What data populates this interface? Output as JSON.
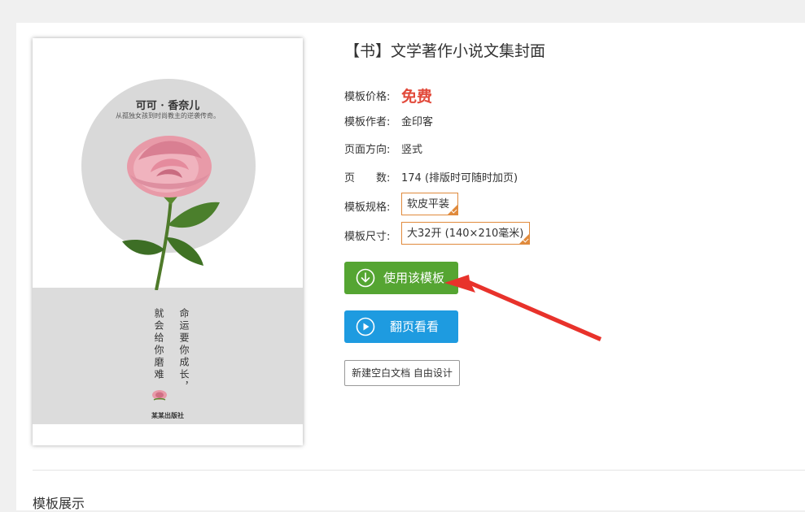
{
  "product": {
    "title": "【书】文学著作小说文集封面",
    "price_label": "模板价格:",
    "price_value": "免费",
    "author_label": "模板作者:",
    "author_value": "金印客",
    "orientation_label": "页面方向:",
    "orientation_value": "竖式",
    "pages_label": "页　　数:",
    "pages_value": "174 (排版时可随时加页)",
    "spec_label": "模板规格:",
    "spec_value": "软皮平装",
    "size_label": "模板尺寸:",
    "size_value": "大32开 (140×210毫米)"
  },
  "cover": {
    "title": "可可 · 香奈儿",
    "subtitle": "从孤独女孩到时尚教主的逆袭传奇。",
    "column_right": "命运要你成长，",
    "column_left": "就会给你磨难",
    "publisher": "某某出版社"
  },
  "actions": {
    "use_template": "使用该模板",
    "flip_view": "翻页看看",
    "blank_doc": "新建空白文档 自由设计"
  },
  "section": {
    "title": "模板展示"
  },
  "colors": {
    "price": "#e24a3b",
    "use_button": "#55a532",
    "flip_button": "#1e9be0",
    "spec_border": "#e08a3c",
    "annotation_arrow": "#e8322b"
  }
}
